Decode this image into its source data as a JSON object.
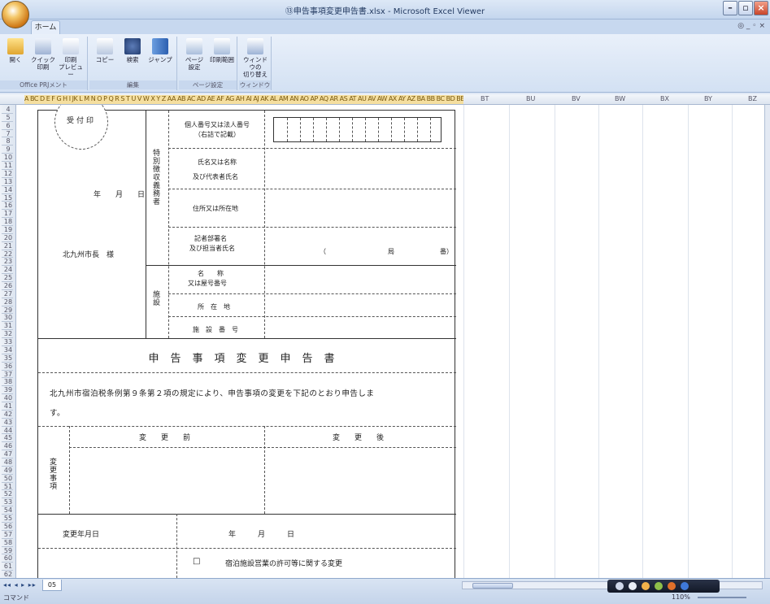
{
  "window": {
    "title": "⑬申告事項変更申告書.xlsx - Microsoft Excel Viewer",
    "min": "–",
    "max": "▫",
    "close": "×"
  },
  "tabs": {
    "home": "ホーム",
    "right": "◎ _ ◦ ×"
  },
  "ribbon": {
    "groups": [
      {
        "label": "Office PRJメント",
        "buttons": [
          "開く",
          "クイック\n印刷",
          "印刷\nプレビュー"
        ]
      },
      {
        "label": "編集",
        "buttons": [
          "コピー",
          "検索",
          "ジャンプ"
        ]
      },
      {
        "label": "ページ設定",
        "buttons": [
          "ページ\n設定",
          "印刷範囲"
        ]
      },
      {
        "label": "ウィンドウ",
        "buttons": [
          "ウィンドウの\n切り替え"
        ]
      }
    ]
  },
  "columns": {
    "compact": "A BC D E F G H I JK L M N O P Q R S T U V W X Y Z AA AB AC AD AE AF AG AH AI AJ AK AL AM AN AO AP AQ AR AS AT AU AV AW AX AY AZ BA BB BC BD BE BF BG BH BI BJ BK BL BM BN BO BP BQ BR BS",
    "wide": [
      "BT",
      "BU",
      "BV",
      "BW",
      "BX",
      "BY",
      "BZ"
    ]
  },
  "rows": [
    "4",
    "5",
    "6",
    "7",
    "8",
    "9",
    "10",
    "11",
    "12",
    "13",
    "14",
    "15",
    "16",
    "17",
    "18",
    "19",
    "20",
    "21",
    "22",
    "23",
    "24",
    "25",
    "26",
    "27",
    "28",
    "29",
    "30",
    "31",
    "32",
    "33",
    "34",
    "35",
    "36",
    "37",
    "38",
    "39",
    "40",
    "41",
    "42",
    "43",
    "44",
    "45",
    "46",
    "47",
    "48",
    "49",
    "50",
    "51",
    "52",
    "53",
    "54",
    "55",
    "56",
    "57",
    "58",
    "59",
    "60",
    "61",
    "62"
  ],
  "form": {
    "stamp": "受付印",
    "date_label": "年　　月　　日",
    "addressee": "北九州市長　様",
    "side_applicant": "特別徴収義務者",
    "side_facility": "施設",
    "labels": {
      "corp_number": "個人番号又は法人番号",
      "corp_number_note": "（右詰で記載）",
      "name1": "氏名又は名称",
      "name2": "及び代表者氏名",
      "address": "住所又は所在地",
      "contact1": "記者部署名",
      "contact2": "及び担当者氏名",
      "phone_open": "（",
      "phone_mid": "局",
      "phone_close": "番）",
      "facility_name1": "名　　称",
      "facility_name2": "又は屋号番号",
      "facility_address": "所　在　地",
      "facility_number": "施　設　番　号"
    },
    "title": "申告事項変更申告書",
    "body_line1": "北九州市宿泊税条例第９条第２項の規定により、申告事項の変更を下記のとおり申告しま",
    "body_line2": "す。",
    "before": "変　　更　　前",
    "after": "変　　更　　後",
    "side_changes": "変更事項",
    "change_date_label": "変更年月日",
    "change_date_value": "年　　　月　　　日",
    "checkbox": "□",
    "checkbox_label": "宿泊施設営業の許可等に関する変更"
  },
  "status": {
    "nav": "◂◂ ◂ ▸ ▸▸",
    "sheet": "05",
    "ready": "コマンド",
    "zoom": "110%"
  }
}
